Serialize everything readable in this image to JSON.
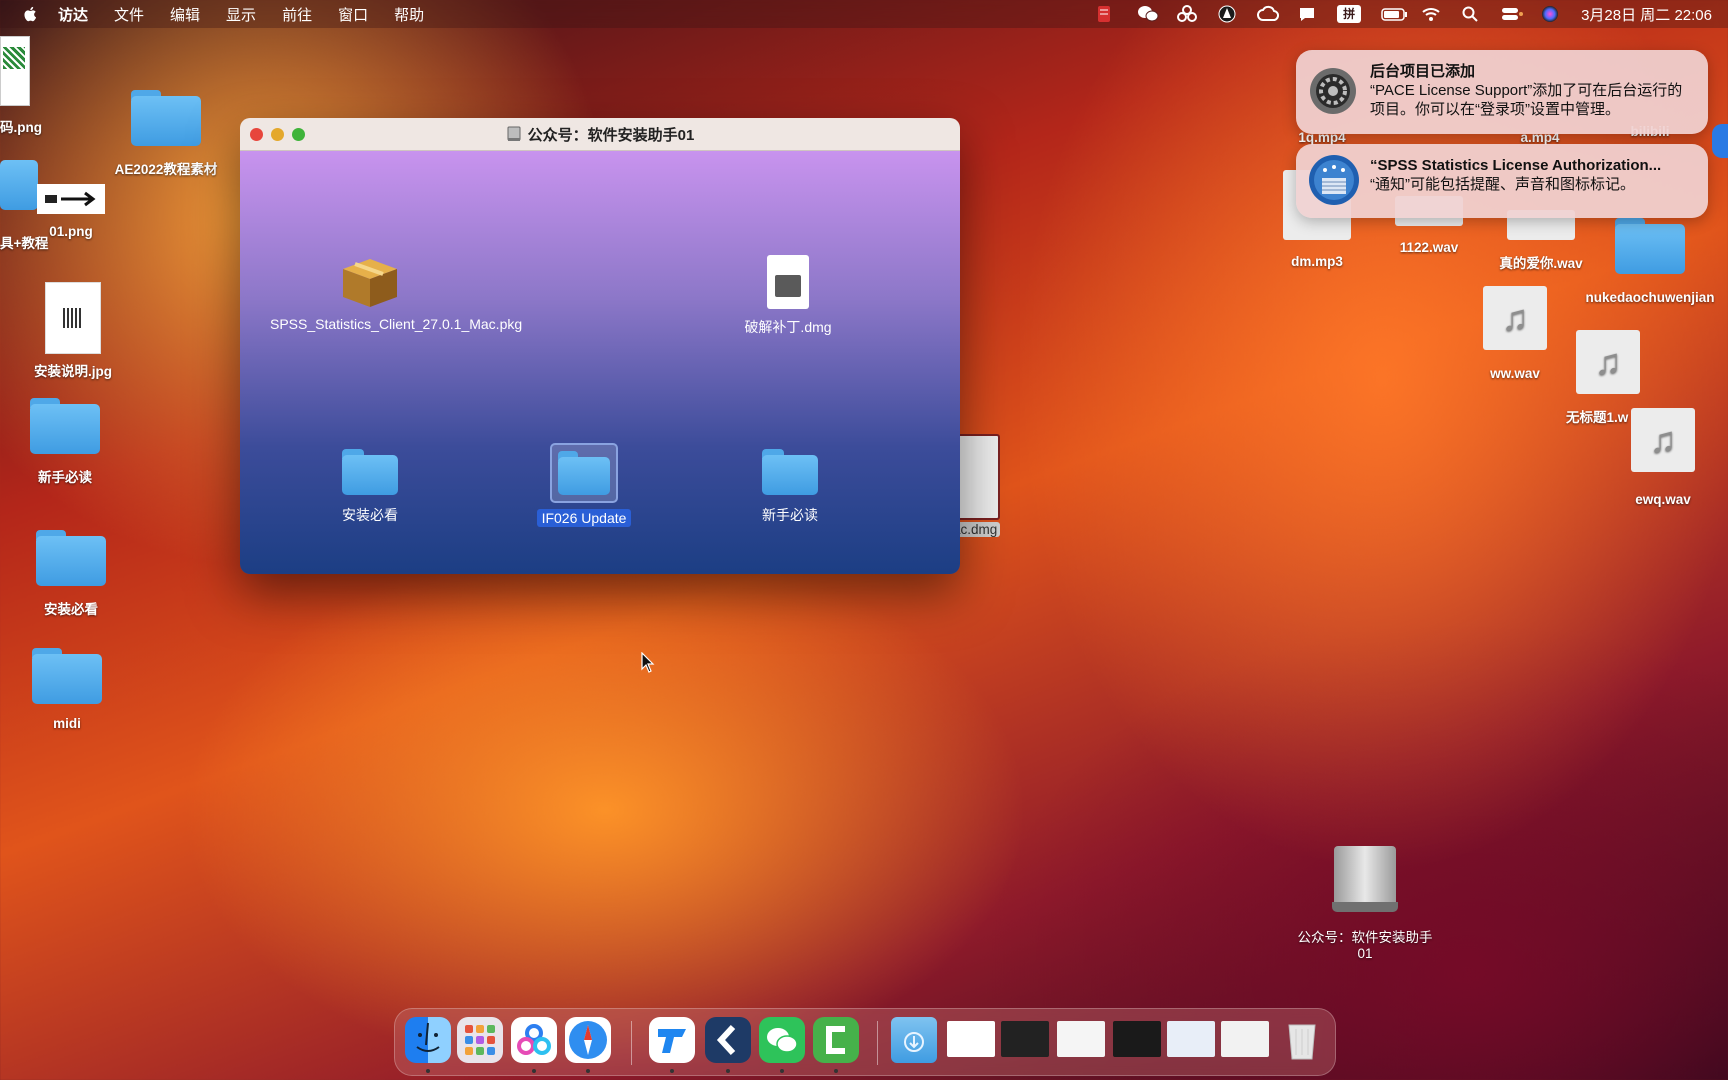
{
  "menubar": {
    "items": [
      "访达",
      "文件",
      "编辑",
      "显示",
      "前往",
      "窗口",
      "帮助"
    ],
    "clock": "3月28日 周二 22:06",
    "input_method": "拼"
  },
  "desktop_icons": [
    {
      "label": "码.png"
    },
    {
      "label": "AE2022教程素材"
    },
    {
      "label": "具+教程"
    },
    {
      "label": "01.png"
    },
    {
      "label": "安装说明.jpg"
    },
    {
      "label": "新手必读"
    },
    {
      "label": "安装必看"
    },
    {
      "label": "midi"
    },
    {
      "label": "ac.dmg"
    },
    {
      "label": "dm.mp3"
    },
    {
      "label": "1122.wav"
    },
    {
      "label": "真的爱你.wav"
    },
    {
      "label": "nukedaochuwenjian"
    },
    {
      "label": "ww.wav"
    },
    {
      "label": "无标题1.w"
    },
    {
      "label": "ewq.wav"
    },
    {
      "label": "1q.mp4"
    },
    {
      "label": "a.mp4"
    },
    {
      "label": "bilibili"
    },
    {
      "label": "公众号：软件安装助手01"
    }
  ],
  "finder": {
    "title": "公众号：软件安装助手01",
    "items": [
      {
        "label": "SPSS_Statistics_Client_27.0.1_Mac.pkg"
      },
      {
        "label": "破解补丁.dmg"
      },
      {
        "label": "安装必看"
      },
      {
        "label": "IF026 Update"
      },
      {
        "label": "新手必读"
      }
    ]
  },
  "notifications": [
    {
      "title": "后台项目已添加",
      "body": "“PACE License Support”添加了可在后台运行的项目。你可以在“登录项”设置中管理。"
    },
    {
      "title": "“SPSS Statistics License Authorization...",
      "body": "“通知”可能包括提醒、声音和图标标记。"
    }
  ],
  "dock": {
    "apps": [
      "Finder",
      "Launchpad",
      "Baidu Netdisk",
      "Safari",
      "ToDesk",
      "Capcut",
      "WeChat",
      "Camtasia"
    ]
  },
  "colors": {
    "selection": "#2a5fd6",
    "folder": "#4fa8e8"
  }
}
